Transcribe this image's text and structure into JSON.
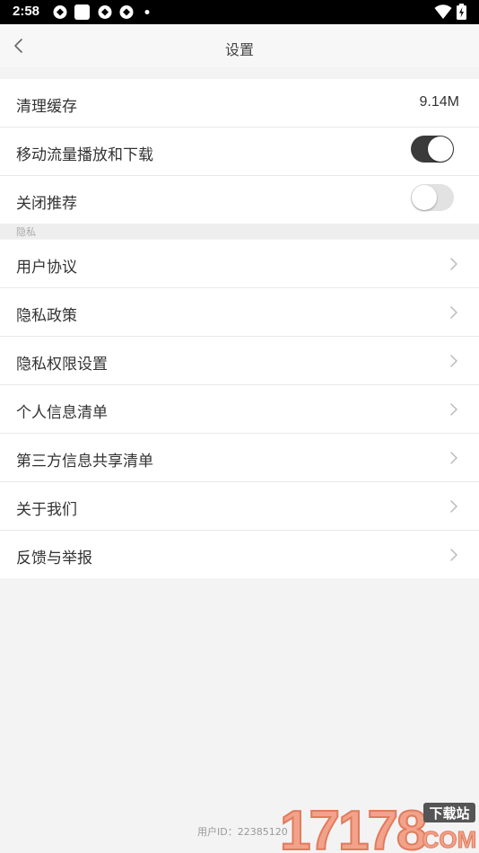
{
  "status_bar": {
    "time": "2:58",
    "icons": [
      "cloud-sync-icon",
      "square-notification-icon",
      "cloud-sync-icon",
      "cloud-sync-icon",
      "dot-icon"
    ],
    "right_icons": [
      "wifi-icon",
      "battery-charging-icon"
    ]
  },
  "nav": {
    "title": "设置"
  },
  "settings": {
    "cache_label": "清理缓存",
    "cache_value": "9.14M",
    "mobile_data_label": "移动流量播放和下载",
    "mobile_data_on": true,
    "recommend_label": "关闭推荐",
    "recommend_on": false
  },
  "privacy_header": "隐私",
  "privacy_items": [
    {
      "label": "用户协议"
    },
    {
      "label": "隐私政策"
    },
    {
      "label": "隐私权限设置"
    },
    {
      "label": "个人信息清单"
    },
    {
      "label": "第三方信息共享清单"
    },
    {
      "label": "关于我们"
    },
    {
      "label": "反馈与举报"
    }
  ],
  "footer": {
    "user_id": "用户ID：22385120"
  },
  "watermark": {
    "text": "17178",
    "sub": "下载站",
    "domain": "COM"
  },
  "colors": {
    "toggle_on": "#3b3b3b",
    "toggle_off": "#e2e2e2",
    "page_bg": "#f3f3f3"
  }
}
